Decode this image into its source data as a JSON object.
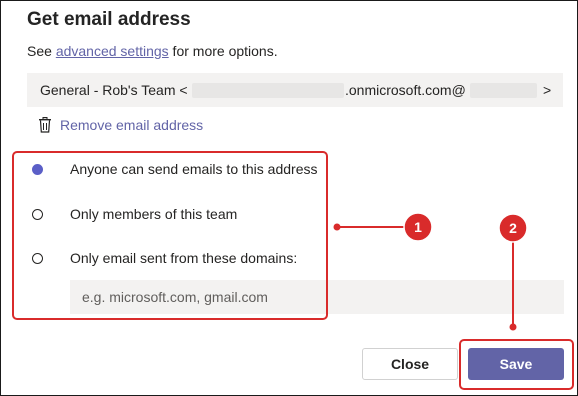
{
  "dialog": {
    "title": "Get email address",
    "subtitle_prefix": "See ",
    "subtitle_link": "advanced settings",
    "subtitle_suffix": " for more options."
  },
  "email": {
    "prefix": "General - Rob's Team <",
    "middle": ".onmicrosoft.com@",
    "suffix": ">"
  },
  "remove_label": "Remove email address",
  "options": [
    {
      "label": "Anyone can send emails to this address",
      "selected": true
    },
    {
      "label": "Only members of this team",
      "selected": false
    },
    {
      "label": "Only email sent from these domains:",
      "selected": false
    }
  ],
  "domains": {
    "placeholder": "e.g. microsoft.com, gmail.com",
    "value": ""
  },
  "buttons": {
    "close": "Close",
    "save": "Save"
  },
  "annotations": [
    {
      "label": "1",
      "color": "#d92b2b"
    },
    {
      "label": "2",
      "color": "#d92b2b"
    }
  ],
  "colors": {
    "accent": "#6264a7",
    "annotation": "#d92b2b",
    "field_bg": "#f3f2f1"
  }
}
